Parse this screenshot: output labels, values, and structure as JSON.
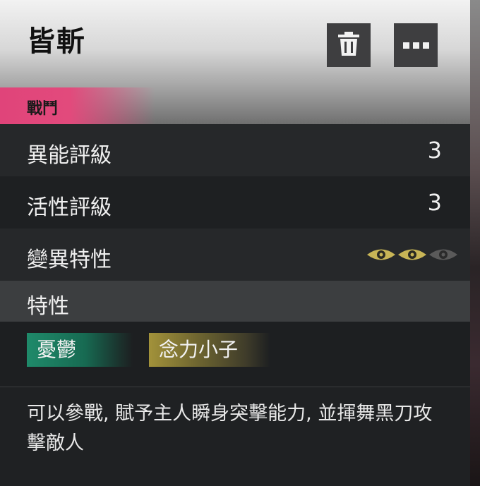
{
  "card": {
    "title": "皆斬",
    "category": "戰鬥",
    "actions": {
      "delete_icon": "trash-icon",
      "more_icon": "more-icon"
    },
    "stats": [
      {
        "label": "異能評級",
        "value": "3"
      },
      {
        "label": "活性評級",
        "value": "3"
      }
    ],
    "mutation": {
      "label": "變異特性",
      "level": 2,
      "max": 3
    },
    "traits_section": {
      "label": "特性",
      "items": [
        {
          "label": "憂鬱",
          "color": "#1f8a6a"
        },
        {
          "label": "念力小子",
          "color": "#a2923a"
        }
      ]
    },
    "description": "可以參戰, 賦予主人瞬身突擊能力, 並揮舞黑刀攻擊敵人"
  },
  "colors": {
    "category_accent": "#e0447a",
    "eye_active": "#c8b556",
    "eye_inactive": "#5a5a5a"
  }
}
